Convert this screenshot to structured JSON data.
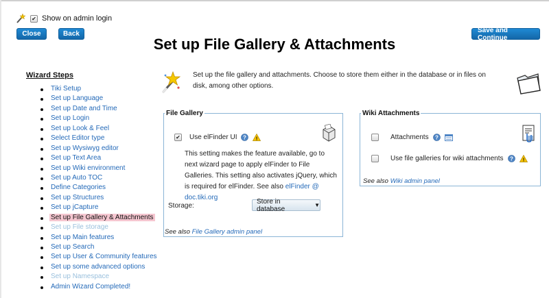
{
  "header": {
    "show_on_admin_login": "Show on admin login",
    "close_label": "Close",
    "back_label": "Back",
    "save_label": "Save and Continue",
    "title": "Set up File Gallery & Attachments"
  },
  "wizard": {
    "heading": "Wizard Steps",
    "steps": [
      {
        "label": "Tiki Setup",
        "state": "link"
      },
      {
        "label": "Set up Language",
        "state": "link"
      },
      {
        "label": "Set up Date and Time",
        "state": "link"
      },
      {
        "label": "Set up Login",
        "state": "link"
      },
      {
        "label": "Set up Look & Feel",
        "state": "link"
      },
      {
        "label": "Select Editor type",
        "state": "link"
      },
      {
        "label": "Set up Wysiwyg editor",
        "state": "link"
      },
      {
        "label": "Set up Text Area",
        "state": "link"
      },
      {
        "label": "Set up Wiki environment",
        "state": "link"
      },
      {
        "label": "Set up Auto TOC",
        "state": "link"
      },
      {
        "label": "Define Categories",
        "state": "link"
      },
      {
        "label": "Set up Structures",
        "state": "link"
      },
      {
        "label": "Set up jCapture",
        "state": "link"
      },
      {
        "label": "Set up File Gallery & Attachments",
        "state": "current"
      },
      {
        "label": "Set up File storage",
        "state": "disabled"
      },
      {
        "label": "Set up Main features",
        "state": "link"
      },
      {
        "label": "Set up Search",
        "state": "link"
      },
      {
        "label": "Set up User & Community features",
        "state": "link"
      },
      {
        "label": "Set up some advanced options",
        "state": "link"
      },
      {
        "label": "Set up Namespace",
        "state": "disabled"
      },
      {
        "label": "Admin Wizard Completed!",
        "state": "link"
      }
    ]
  },
  "intro": {
    "text": "Set up the file gallery and attachments. Choose to store them either in the database or in files on disk, among other options."
  },
  "file_gallery": {
    "legend": "File Gallery",
    "elfinder_label": "Use elFinder UI",
    "elfinder_checked": true,
    "description": "This setting makes the feature available, go to next wizard page to apply elFinder to File Galleries. This setting also activates jQuery, which is required for elFinder. See also ",
    "description_link": "elFinder @ doc.tiki.org",
    "storage_label": "Storage:",
    "storage_value": "Store in database",
    "see_also_prefix": "See also ",
    "see_also_link": "File Gallery admin panel"
  },
  "wiki_attachments": {
    "legend": "Wiki Attachments",
    "attachments_label": "Attachments",
    "attachments_checked": false,
    "use_fg_label": "Use file galleries for wiki attachments",
    "use_fg_checked": false,
    "see_also_prefix": "See also ",
    "see_also_link": "Wiki admin panel"
  },
  "colors": {
    "button_blue": "#1a7cc4",
    "link_blue": "#2369b8",
    "current_step_bg": "#f5c6d0",
    "fieldset_border": "#8ab4d6"
  }
}
